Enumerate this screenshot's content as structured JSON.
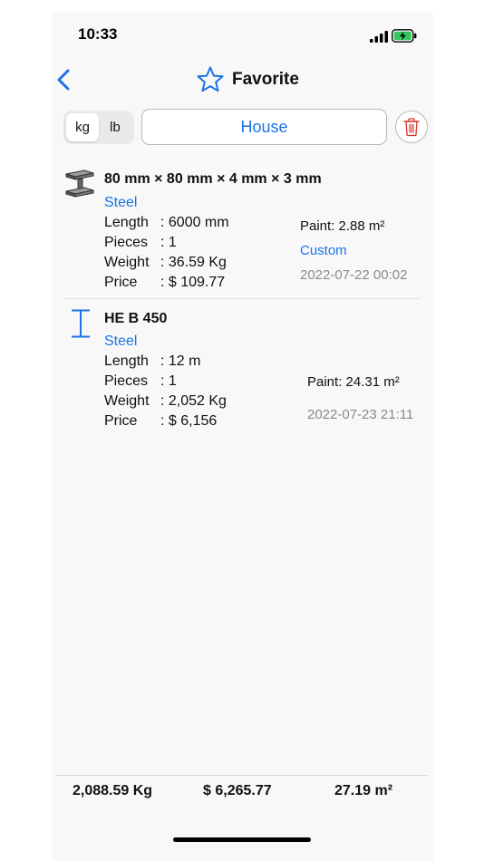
{
  "status_bar": {
    "time": "10:33"
  },
  "nav": {
    "title": "Favorite"
  },
  "controls": {
    "units": [
      "kg",
      "lb"
    ],
    "selected_unit": "kg",
    "project_name": "House"
  },
  "items": [
    {
      "title": "80 mm × 80 mm × 4 mm × 3 mm",
      "material": "Steel",
      "icon": "i-beam-3d-icon",
      "rows": [
        {
          "label": "Length",
          "value": ": 6000 mm"
        },
        {
          "label": "Pieces",
          "value": ": 1"
        },
        {
          "label": "Weight",
          "value": ": 36.59 Kg"
        },
        {
          "label": "Price",
          "value": ": $ 109.77"
        }
      ],
      "paint": "Paint: 2.88 m²",
      "custom": "Custom",
      "date": "2022-07-22 00:02"
    },
    {
      "title": "HE B 450",
      "material": "Steel",
      "icon": "i-beam-outline-icon",
      "rows": [
        {
          "label": "Length",
          "value": ": 12 m"
        },
        {
          "label": "Pieces",
          "value": ": 1"
        },
        {
          "label": "Weight",
          "value": ": 2,052 Kg"
        },
        {
          "label": "Price",
          "value": ": $ 6,156"
        }
      ],
      "paint": "Paint: 24.31 m²",
      "date": "2022-07-23 21:11"
    }
  ],
  "totals": {
    "weight": "2,088.59 Kg",
    "price": "$ 6,265.77",
    "paint": "27.19 m²"
  },
  "colors": {
    "accent": "#1a73e8",
    "trash": "#d9342b"
  }
}
